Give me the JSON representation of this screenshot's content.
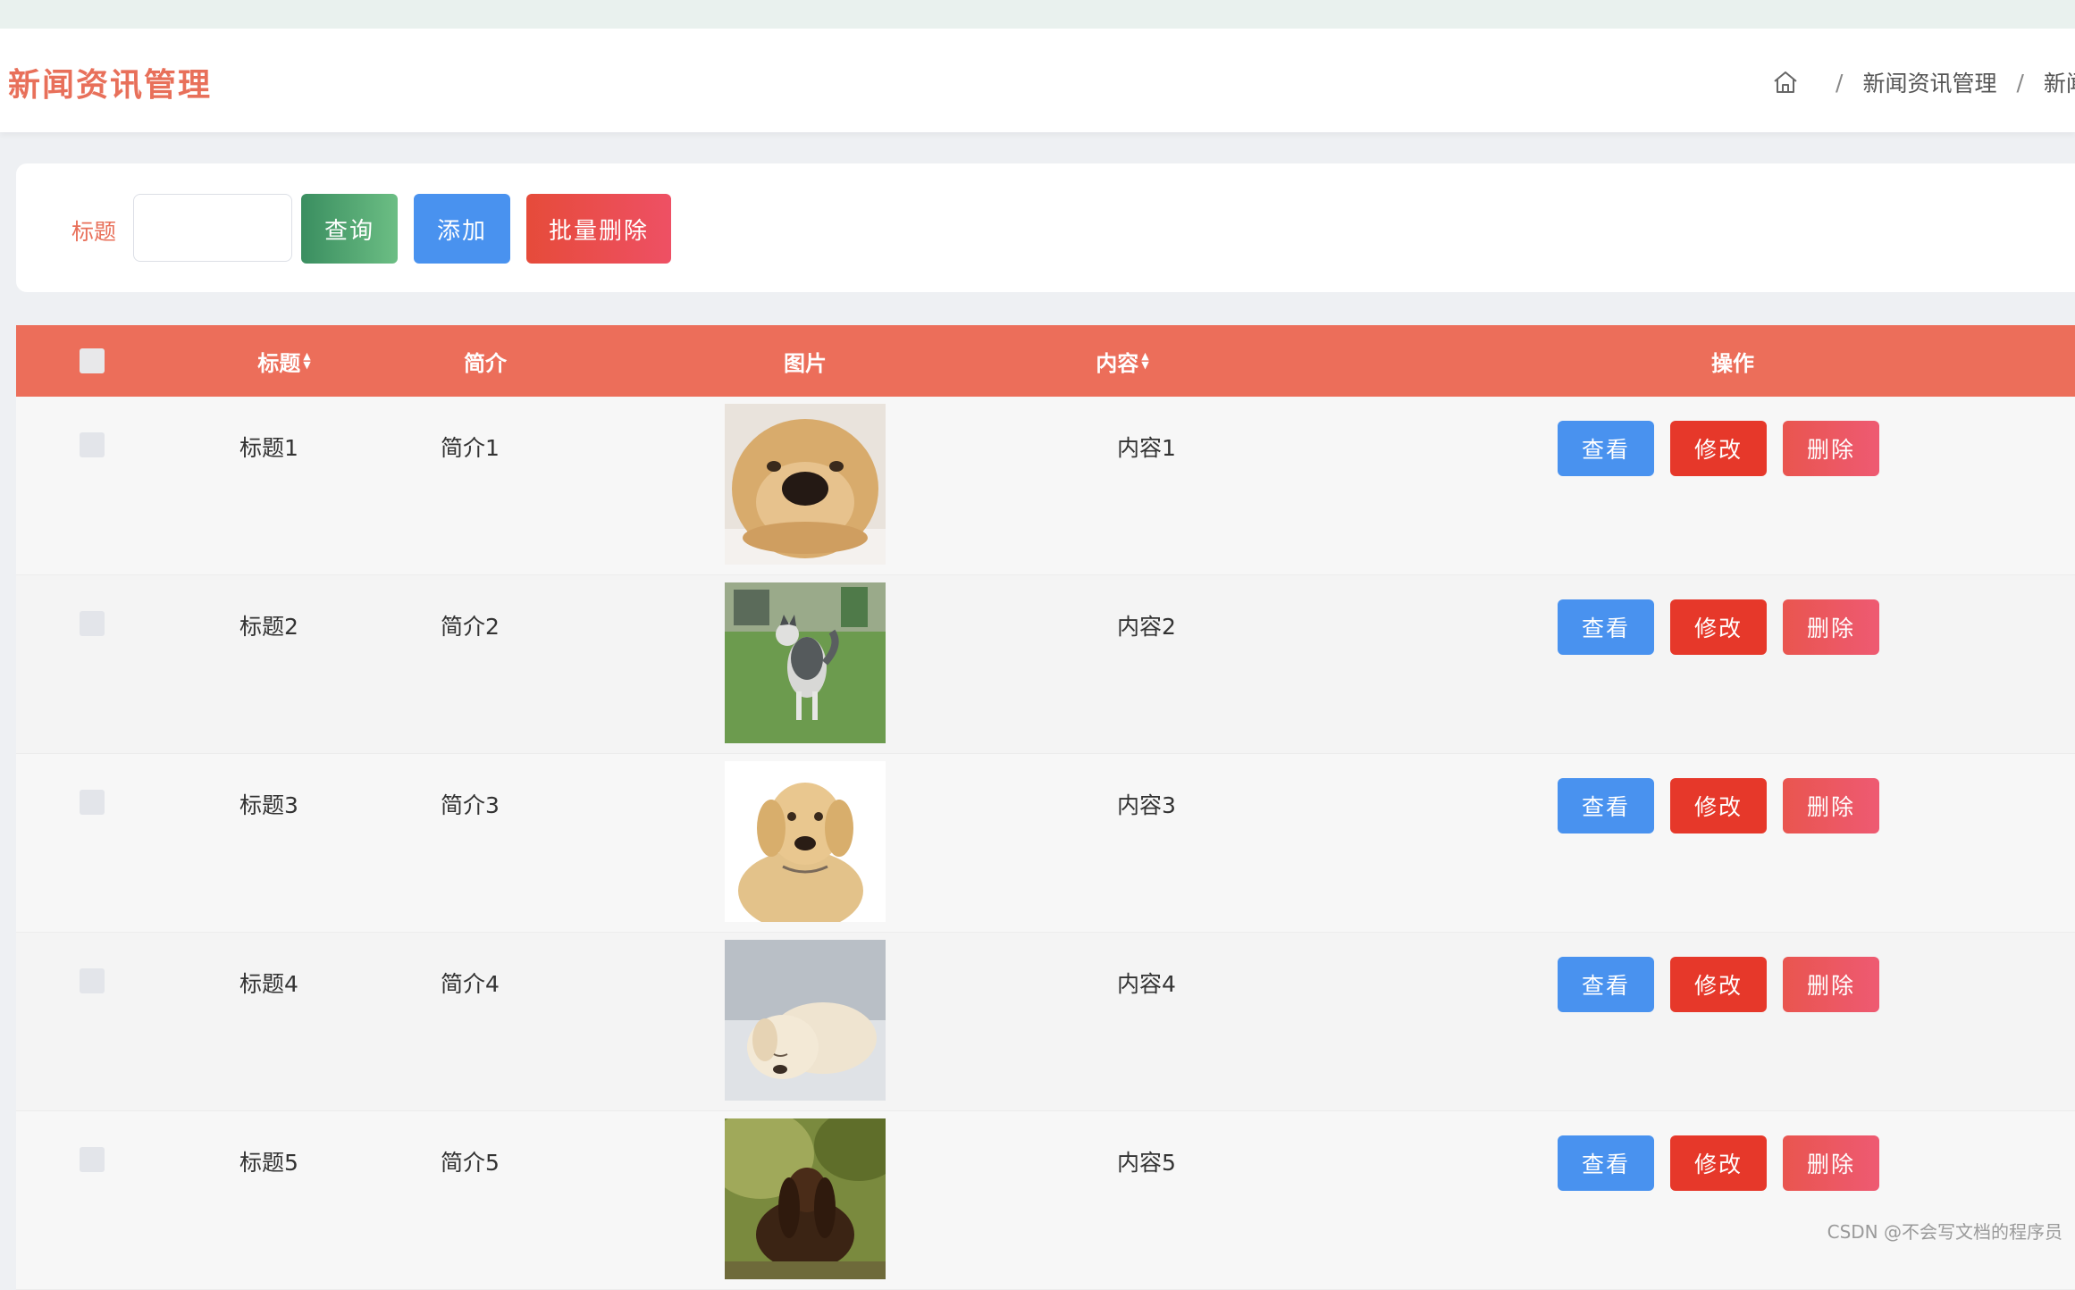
{
  "header": {
    "title": "新闻资讯管理",
    "breadcrumb": [
      "新闻资讯管理",
      "新闻"
    ]
  },
  "search": {
    "label": "标题",
    "value": "",
    "query_label": "查询",
    "add_label": "添加",
    "batch_delete_label": "批量删除"
  },
  "table": {
    "columns": {
      "title": "标题",
      "summary": "简介",
      "image": "图片",
      "content": "内容",
      "actions": "操作"
    },
    "rows": [
      {
        "title": "标题1",
        "summary": "简介1",
        "content": "内容1",
        "image": "golden-puppy-face"
      },
      {
        "title": "标题2",
        "summary": "简介2",
        "content": "内容2",
        "image": "husky-on-grass"
      },
      {
        "title": "标题3",
        "summary": "简介3",
        "content": "内容3",
        "image": "labrador-puppy-sitting"
      },
      {
        "title": "标题4",
        "summary": "简介4",
        "content": "内容4",
        "image": "sleeping-puppy"
      },
      {
        "title": "标题5",
        "summary": "简介5",
        "content": "内容5",
        "image": "dark-dog-outdoors"
      }
    ],
    "actions": {
      "view": "查看",
      "edit": "修改",
      "delete": "删除"
    }
  },
  "colors": {
    "accent": "#e8705a",
    "table_header": "#ec6e5a",
    "btn_blue": "#4992ef",
    "btn_red": "#e6382a",
    "btn_green": "#3a8e60"
  },
  "watermark": "CSDN @不会写文档的程序员"
}
